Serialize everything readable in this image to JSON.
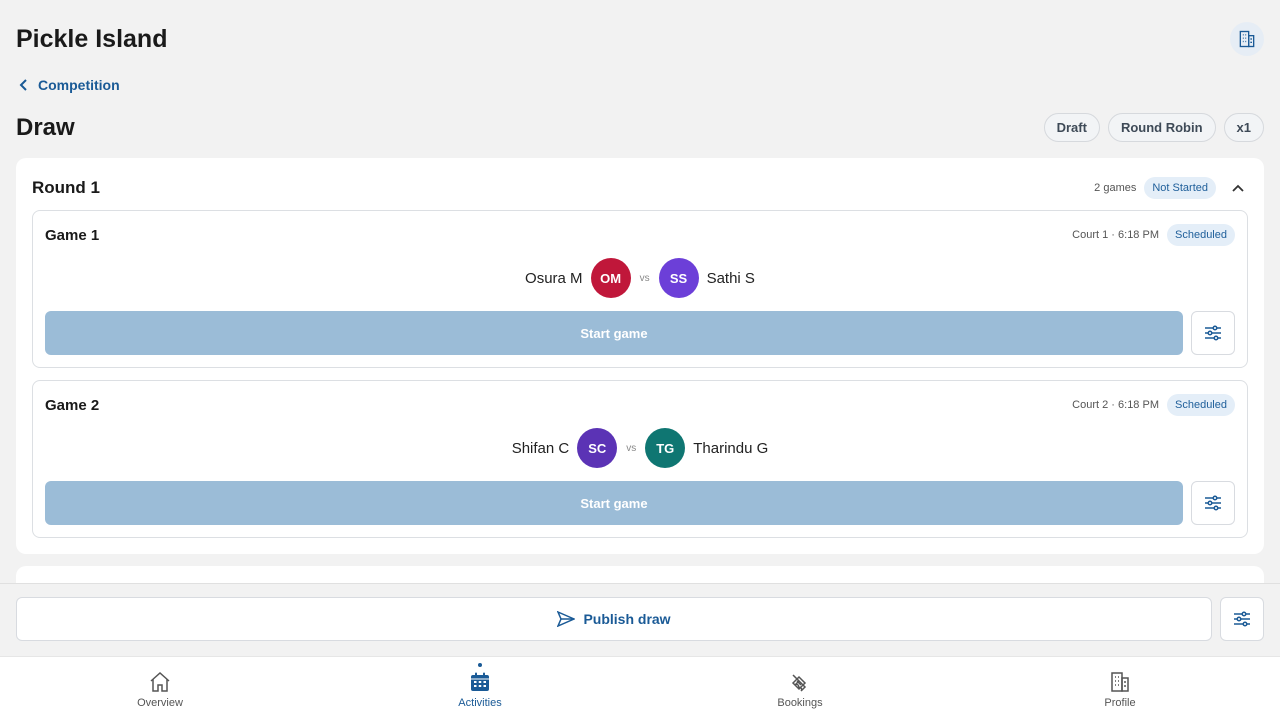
{
  "header": {
    "app_title": "Pickle Island",
    "back_label": "Competition",
    "page_title": "Draw",
    "chips": [
      "Draft",
      "Round Robin",
      "x1"
    ]
  },
  "round": {
    "title": "Round 1",
    "games_count": "2 games",
    "status": "Not Started",
    "games": [
      {
        "title": "Game 1",
        "meta": "Court 1 · 6:18 PM",
        "status": "Scheduled",
        "player1": {
          "name": "Osura M",
          "initials": "OM",
          "color": "#c0173a"
        },
        "player2": {
          "name": "Sathi S",
          "initials": "SS",
          "color": "#6c3fd8"
        },
        "vs": "vs",
        "start_label": "Start game"
      },
      {
        "title": "Game 2",
        "meta": "Court 2 · 6:18 PM",
        "status": "Scheduled",
        "player1": {
          "name": "Shifan C",
          "initials": "SC",
          "color": "#5b33b5"
        },
        "player2": {
          "name": "Tharindu G",
          "initials": "TG",
          "color": "#0f7672"
        },
        "vs": "vs",
        "start_label": "Start game"
      }
    ]
  },
  "footer": {
    "publish_label": "Publish draw"
  },
  "nav": {
    "items": [
      {
        "label": "Overview",
        "icon": "home-icon"
      },
      {
        "label": "Activities",
        "icon": "calendar-icon",
        "active": true
      },
      {
        "label": "Bookings",
        "icon": "ticket-icon"
      },
      {
        "label": "Profile",
        "icon": "building-icon"
      }
    ]
  },
  "colors": {
    "accent": "#1a5a96",
    "start_button": "#9bbcd7",
    "background": "#f2f2f2"
  }
}
